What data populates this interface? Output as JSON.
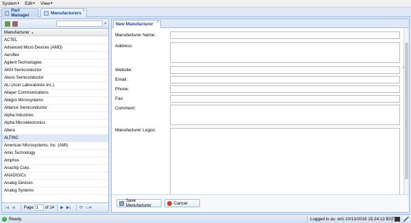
{
  "menubar": {
    "items": [
      {
        "label": "System"
      },
      {
        "label": "Edit"
      },
      {
        "label": "View"
      }
    ]
  },
  "tabs": [
    {
      "label": "Part Manager"
    },
    {
      "label": "Manufacturers",
      "active": true
    }
  ],
  "left": {
    "search": {
      "value": "",
      "placeholder": ""
    },
    "column": "Manufacturer",
    "selected": "ALTINC",
    "rows": [
      "ACTEL",
      "Advanced Micro Devices (AMD)",
      "Aeroflex",
      "Agilent Technologies",
      "AKM Semiconductor",
      "Alesis Semiconductor",
      "ALi (Acer Laboratories Inc.)",
      "Allayer Communications",
      "Allegro Microsystems",
      "Alliance Semiconductor",
      "Alpha Industries",
      "Alpha Microelectronics",
      "Altera",
      "ALTINC",
      "American Microsystems, Inc. (AMI)",
      "Amic Technology",
      "Amphus",
      "Anachip Corp.",
      "ANADIGICs",
      "Analog Devices",
      "Analog Systems"
    ],
    "pager": {
      "page_label": "Page",
      "page_value": "1",
      "of_label": "of 14"
    }
  },
  "right": {
    "tab": "New Manufacturer",
    "form": {
      "name": "Manufacturer Name:",
      "address": "Address:",
      "website": "Website:",
      "email": "Email:",
      "phone": "Phone:",
      "fax": "Fax:",
      "comment": "Comment:",
      "logos": "Manufacturer Logos:"
    },
    "buttons": {
      "save": "Save Manufacturer",
      "cancel": "Cancel"
    }
  },
  "status": {
    "ready": "Ready.",
    "logged_in": "Logged in as: erik",
    "datetime": "10/13/2016 15:24:13 BST"
  },
  "colors": {
    "accent": "#15428b",
    "border": "#99bbe8",
    "panel_bg": "#dfe8f6",
    "selected_row": "#dfe8f6"
  },
  "icons": {
    "add": "add-icon",
    "delete": "delete-icon",
    "search": "search-icon",
    "globe": "globe-icon",
    "save": "save-icon",
    "cancel": "cancel-icon"
  }
}
